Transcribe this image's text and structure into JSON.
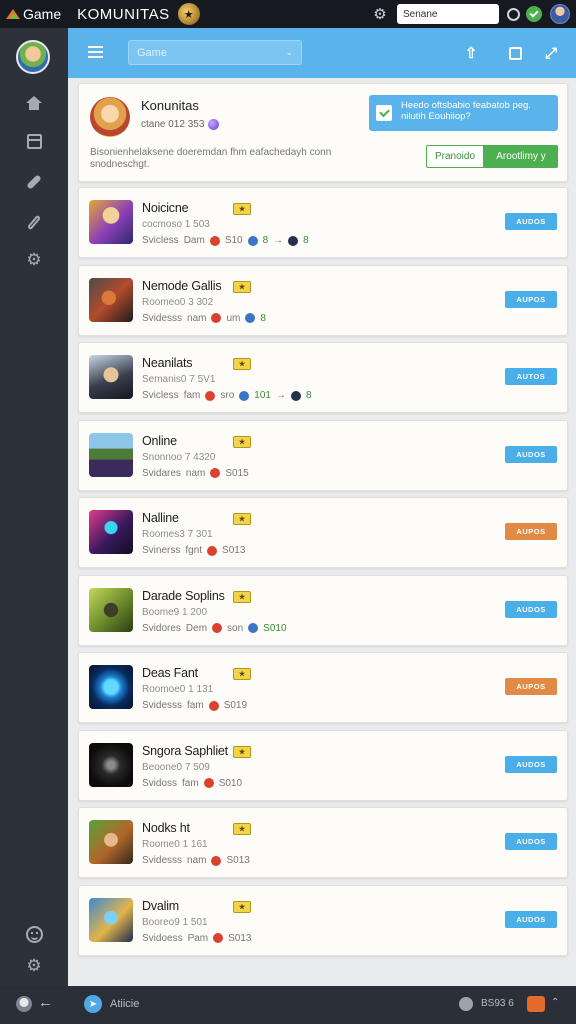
{
  "topbar": {
    "brand": "Game",
    "app_title": "KOMUNITAS",
    "search_value": "Senane"
  },
  "header": {
    "game_select": "Game"
  },
  "community": {
    "name": "Konunitas",
    "stats": "ctane 012 353",
    "description": "Bisonienhelaksene doeremdan fhm eafachedayh conn snodneschgt.",
    "notice": "Heedo oftsbabio feabatob peg. nilutih Eouhiiop?",
    "button_outline": "Pranoido",
    "button_fill": "Arootlimy y"
  },
  "colors": {
    "accent_blue": "#5ab3ea",
    "action_blue": "#4aaee8",
    "action_orange": "#e08a45",
    "success_green": "#4caf50",
    "sidebar": "#2d323a"
  },
  "games": [
    {
      "title": "Noicicne",
      "sub": "cocmoso 1 503",
      "meta_a": "Svicless",
      "meta_b": "Dam",
      "meta_c": "S10",
      "extra": "8",
      "extra2": "8",
      "action": "AUDOS",
      "action_color": "blue",
      "thumb": "wizard"
    },
    {
      "title": "Nemode Gallis",
      "sub": "Roomeo0 3 302",
      "meta_a": "Svidesss",
      "meta_b": "nam",
      "meta_c": "um",
      "extra": "8",
      "extra2": "",
      "action": "AUPOS",
      "action_color": "blue",
      "thumb": "robot"
    },
    {
      "title": "Neanilats",
      "sub": "Semanis0 7 5V1",
      "meta_a": "Svicless",
      "meta_b": "fam",
      "meta_c": "sro",
      "extra": "101",
      "extra2": "8",
      "action": "AUTOS",
      "action_color": "blue",
      "thumb": "pirate"
    },
    {
      "title": "Online",
      "sub": "Snonnoo 7 4320",
      "meta_a": "Svidares",
      "meta_b": "nam",
      "meta_c": "S015",
      "extra": "",
      "extra2": "",
      "action": "AUDOS",
      "action_color": "blue",
      "thumb": "castle"
    },
    {
      "title": "Nalline",
      "sub": "Roomes3 7 301",
      "meta_a": "Svinerss",
      "meta_b": "fgnt",
      "meta_c": "S013",
      "extra": "",
      "extra2": "",
      "action": "AUPOS",
      "action_color": "orange",
      "thumb": "neon"
    },
    {
      "title": "Darade Soplins",
      "sub": "Boome9 1 200",
      "meta_a": "Svidores",
      "meta_b": "Dem",
      "meta_c": "son",
      "extra": "S010",
      "extra2": "",
      "action": "AUDOS",
      "action_color": "blue",
      "thumb": "dragon"
    },
    {
      "title": "Deas Fant",
      "sub": "Roomoe0 1 131",
      "meta_a": "Svidesss",
      "meta_b": "fam",
      "meta_c": "S019",
      "extra": "",
      "extra2": "",
      "action": "AUPOS",
      "action_color": "orange",
      "thumb": "orb"
    },
    {
      "title": "Sngora Saphliet",
      "sub": "Beoone0 7 509",
      "meta_a": "Svidoss",
      "meta_b": "fam",
      "meta_c": "S010",
      "extra": "",
      "extra2": "",
      "action": "AUDOS",
      "action_color": "blue",
      "thumb": "shadow"
    },
    {
      "title": "Nodks ht",
      "sub": "Roome0 1 161",
      "meta_a": "Svidesss",
      "meta_b": "nam",
      "meta_c": "S013",
      "extra": "",
      "extra2": "",
      "action": "AUDOS",
      "action_color": "blue",
      "thumb": "ranger"
    },
    {
      "title": "Dvalim",
      "sub": "Booreo9 1 501",
      "meta_a": "Svidoess",
      "meta_b": "Pam",
      "meta_c": "S013",
      "extra": "",
      "extra2": "",
      "action": "AUDOS",
      "action_color": "blue",
      "thumb": "beast"
    }
  ],
  "bottombar": {
    "label": "Atiicie",
    "count": "BS93 6"
  }
}
